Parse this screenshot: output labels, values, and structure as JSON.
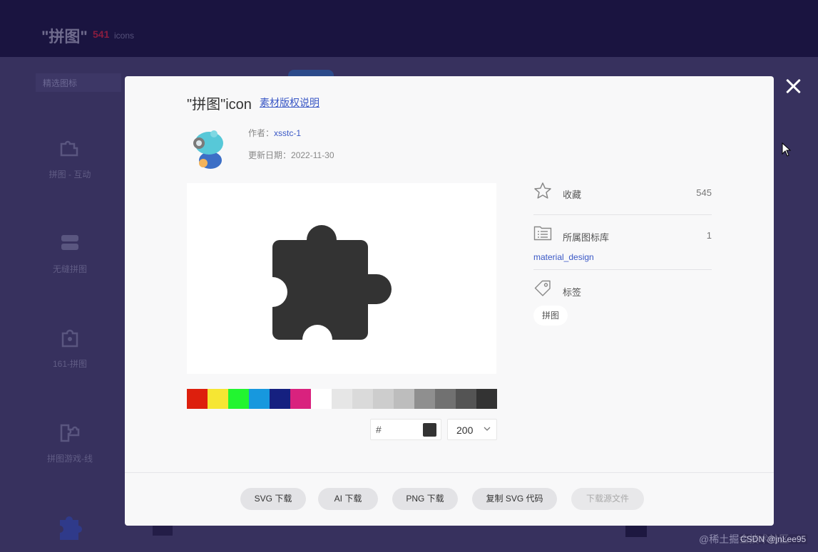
{
  "background": {
    "title": "\"拼图\"",
    "count": "541",
    "icons_word": "icons",
    "filter_label": "精选图标",
    "items": [
      {
        "label": "拼图 - 互动"
      },
      {
        "label": "无缝拼图"
      },
      {
        "label": "161-拼图"
      },
      {
        "label": "拼图游戏-线"
      }
    ]
  },
  "modal": {
    "title": "\"拼图\"icon",
    "copyright_link": "素材版权说明",
    "author_label": "作者：",
    "author_name": "xsstc-1",
    "date_label": "更新日期：",
    "date_value": "2022-11-30",
    "palette": [
      "#dd1f0d",
      "#f6e633",
      "#22f530",
      "#1798de",
      "#152080",
      "#d9227e",
      "#ffffff",
      "#e6e6e6",
      "#dadada",
      "#cdcdcd",
      "#bdbdbd",
      "#8f8f8f",
      "#717171",
      "#545454",
      "#333333"
    ],
    "color_hex_prefix": "#",
    "color_hex_value": "",
    "size_value": "200",
    "favorite_label": "收藏",
    "favorite_count": "545",
    "library_label": "所属图标库",
    "library_count": "1",
    "library_name": "material_design",
    "tags_label": "标签",
    "tags": [
      "拼图"
    ],
    "buttons": {
      "svg": "SVG 下载",
      "ai": "AI 下载",
      "png": "PNG 下载",
      "copy_svg": "复制 SVG 代码",
      "source": "下载源文件"
    }
  },
  "watermark": {
    "text": "@稀土掘金技术社区",
    "csdn": "CSDN @jnLee95"
  }
}
